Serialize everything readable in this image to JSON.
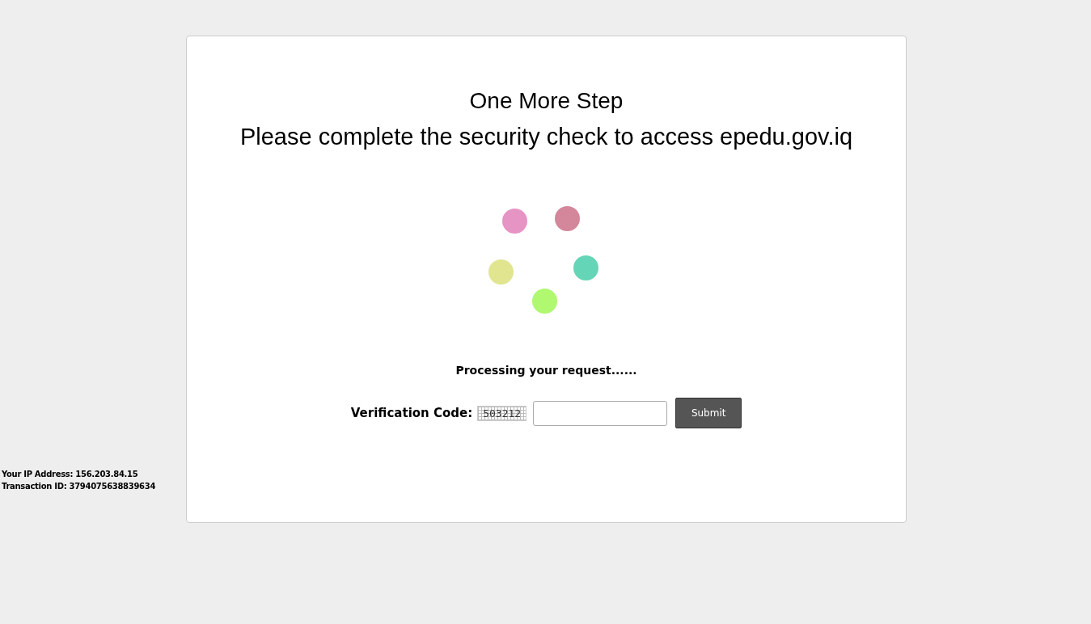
{
  "title": "One More Step",
  "subtitle": "Please complete the security check to access epedu.gov.iq",
  "loader": {
    "dots": [
      {
        "color": "#e694c4"
      },
      {
        "color": "#d4879a"
      },
      {
        "color": "#64d5b6"
      },
      {
        "color": "#aff870"
      },
      {
        "color": "#e1e58f"
      }
    ]
  },
  "status": "Processing your request......",
  "verification": {
    "label": "Verification Code:",
    "code": "503212",
    "button": "Submit"
  },
  "footer": {
    "ip": "Your IP Address: 156.203.84.15",
    "transaction": "Transaction ID: 3794075638839634"
  }
}
